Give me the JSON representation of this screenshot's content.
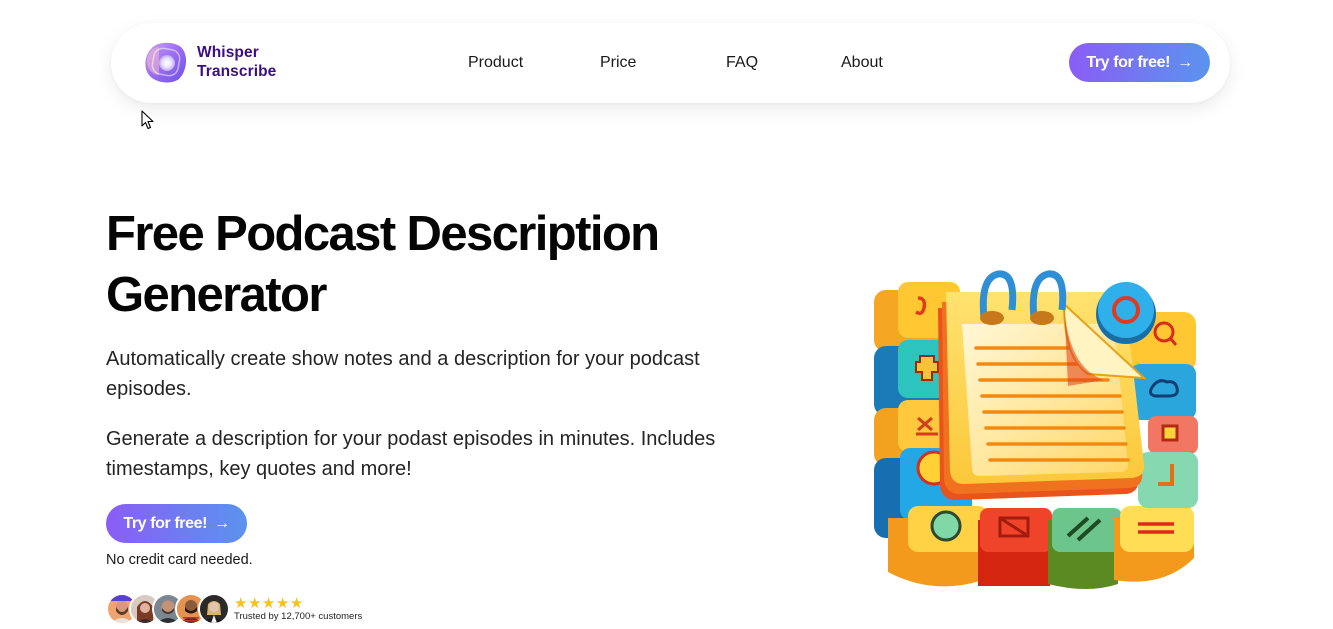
{
  "nav": {
    "brand_line1": "Whisper",
    "brand_line2": "Transcribe",
    "logo_icon": "whisper-logo-icon",
    "links": [
      {
        "label": "Product"
      },
      {
        "label": "Price"
      },
      {
        "label": "FAQ"
      },
      {
        "label": "About"
      }
    ],
    "cta_label": "Try for free!",
    "cta_arrow": "→"
  },
  "hero": {
    "title": "Free Podcast Description Generator",
    "subtitle": "Automatically create show notes and a description for your podcast episodes.",
    "description": "Generate a description for your podast episodes in minutes. Includes timestamps, key quotes and more!",
    "cta_label": "Try for free!",
    "cta_arrow": "→",
    "cta_note": "No credit card needed.",
    "illustration_icon": "notepad-blocks-illustration"
  },
  "trust": {
    "rating_stars": 5,
    "star_glyph": "★",
    "text": "Trusted by 12,700+ customers",
    "avatar_count": 5
  },
  "colors": {
    "brand_text": "#3b0f82",
    "cta_gradient_start": "#8b5cf6",
    "cta_gradient_end": "#5b93ef",
    "star": "#f7c21a"
  }
}
